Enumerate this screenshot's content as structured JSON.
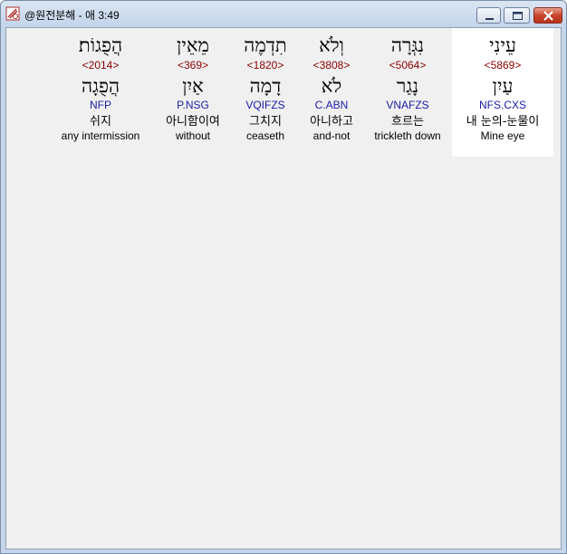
{
  "window": {
    "title": "@원전분해 - 애 3:49"
  },
  "words": [
    {
      "hebrew": "הֲפֻגוֹת׃",
      "strong": "<2014>",
      "lemma": "הֲפֻגָה",
      "morph": "NFP",
      "korean": "쉬지",
      "english": "any intermission"
    },
    {
      "hebrew": "מֵאֵין",
      "strong": "<369>",
      "lemma": "אַיִן",
      "morph": "P.NSG",
      "korean": "아니함이여",
      "english": "without"
    },
    {
      "hebrew": "תִדְמֶה",
      "strong": "<1820>",
      "lemma": "דָמָה",
      "morph": "VQIFZS",
      "korean": "그치지",
      "english": "ceaseth"
    },
    {
      "hebrew": "וְלֹא",
      "strong": "<3808>",
      "lemma": "לֹא",
      "morph": "C.ABN",
      "korean": "아니하고",
      "english": "and-not"
    },
    {
      "hebrew": "נִגְּרָה",
      "strong": "<5064>",
      "lemma": "נָגַר",
      "morph": "VNAFZS",
      "korean": "흐르는",
      "english": "trickleth down"
    },
    {
      "hebrew": "עֵינִי",
      "strong": "<5869>",
      "lemma": "עַיִן",
      "morph": "NFS.CXS",
      "korean": "내 눈의-눈물이",
      "english": "Mine eye"
    }
  ]
}
